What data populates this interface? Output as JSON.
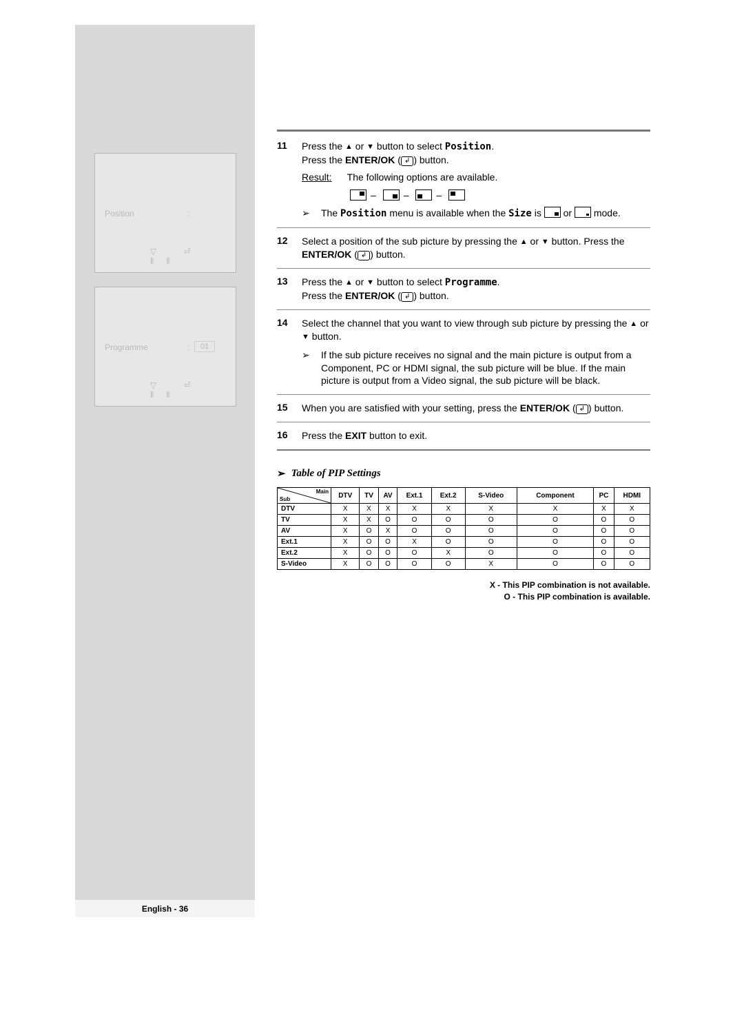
{
  "osd": {
    "position_label": "Position",
    "programme_label": "Programme",
    "programme_value": "01",
    "colon": ":",
    "icons": "▽   ⏎   ⦀⦀"
  },
  "steps": {
    "s11": {
      "num": "11",
      "a": "Press the ",
      "b": " or ",
      "c": " button to select ",
      "target": "Position",
      "d": ".",
      "e": "Press the ",
      "f": "ENTER/OK",
      "g": " (",
      "h": ") button.",
      "result_label": "Result:",
      "result_text": "The following options are available.",
      "note": "The ",
      "note_target": "Position",
      "note2": " menu is available when the ",
      "note_size": "Size",
      "note3": " is ",
      "note_or": " or ",
      "note_mode": " mode."
    },
    "s12": {
      "num": "12",
      "a": "Select a position of the sub picture by pressing the ",
      "b": " or ",
      "c": " button. Press the ",
      "d": "ENTER/OK",
      "e": " (",
      "f": ") button."
    },
    "s13": {
      "num": "13",
      "a": "Press the ",
      "b": " or ",
      "c": " button to select ",
      "target": "Programme",
      "d": ".",
      "e": "Press the ",
      "f": "ENTER/OK",
      "g": " (",
      "h": ") button."
    },
    "s14": {
      "num": "14",
      "a": "Select the channel that you want to view through sub picture by pressing the ",
      "b": " or ",
      "c": " button.",
      "note": "If the sub picture receives no signal and the main picture is output from a Component, PC or HDMI signal, the sub picture will be blue. If the main picture is output from a Video signal, the sub picture will be black."
    },
    "s15": {
      "num": "15",
      "a": "When you are satisfied with your setting, press the ",
      "b": "ENTER/OK",
      "c": " (",
      "d": ") button."
    },
    "s16": {
      "num": "16",
      "a": "Press the ",
      "b": "EXIT",
      "c": " button to exit."
    }
  },
  "chev": "➢",
  "up": "▲",
  "down": "▼",
  "enter_glyph": "↲",
  "table_title": "Table of PIP Settings",
  "chart_data": {
    "type": "table",
    "diag_main": "Main",
    "diag_sub": "Sub",
    "columns": [
      "DTV",
      "TV",
      "AV",
      "Ext.1",
      "Ext.2",
      "S-Video",
      "Component",
      "PC",
      "HDMI"
    ],
    "rows": [
      {
        "label": "DTV",
        "cells": [
          "X",
          "X",
          "X",
          "X",
          "X",
          "X",
          "X",
          "X",
          "X"
        ]
      },
      {
        "label": "TV",
        "cells": [
          "X",
          "X",
          "O",
          "O",
          "O",
          "O",
          "O",
          "O",
          "O"
        ]
      },
      {
        "label": "AV",
        "cells": [
          "X",
          "O",
          "X",
          "O",
          "O",
          "O",
          "O",
          "O",
          "O"
        ]
      },
      {
        "label": "Ext.1",
        "cells": [
          "X",
          "O",
          "O",
          "X",
          "O",
          "O",
          "O",
          "O",
          "O"
        ]
      },
      {
        "label": "Ext.2",
        "cells": [
          "X",
          "O",
          "O",
          "O",
          "X",
          "O",
          "O",
          "O",
          "O"
        ]
      },
      {
        "label": "S-Video",
        "cells": [
          "X",
          "O",
          "O",
          "O",
          "O",
          "X",
          "O",
          "O",
          "O"
        ]
      }
    ]
  },
  "legend": {
    "x": "X - This PIP combination is not available.",
    "o": "O - This PIP combination is available."
  },
  "footer": "English - 36"
}
